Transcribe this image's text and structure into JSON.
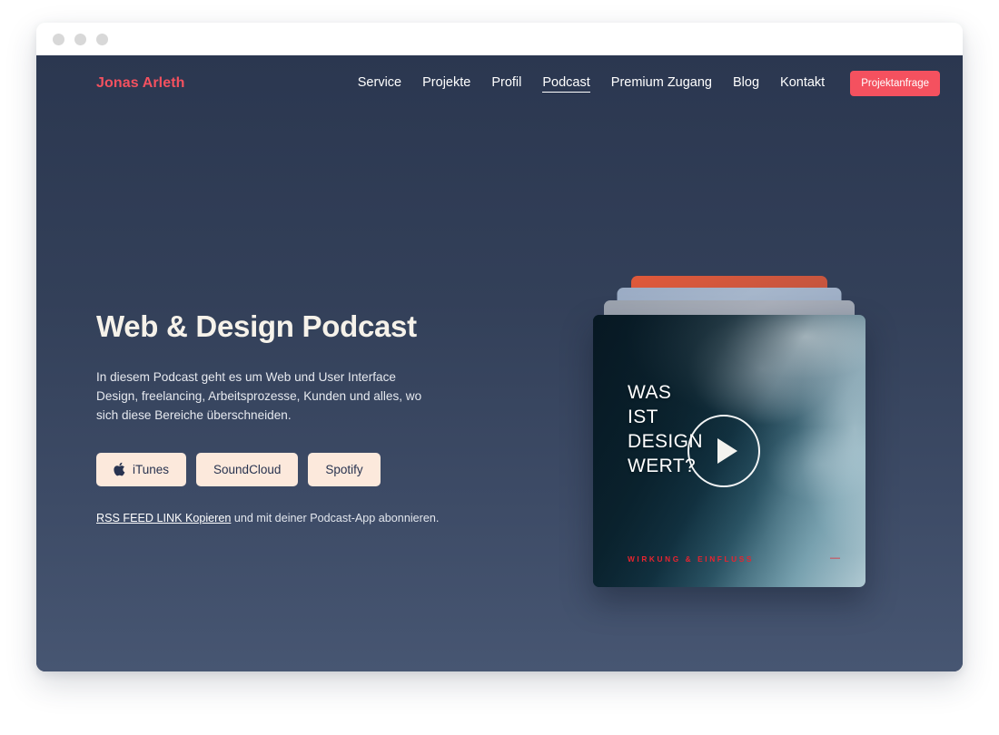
{
  "window": {
    "traffic_lights": [
      "close",
      "minimize",
      "zoom"
    ]
  },
  "nav": {
    "brand": "Jonas Arleth",
    "links": [
      {
        "label": "Service",
        "active": false
      },
      {
        "label": "Projekte",
        "active": false
      },
      {
        "label": "Profil",
        "active": false
      },
      {
        "label": "Podcast",
        "active": true
      },
      {
        "label": "Premium Zugang",
        "active": false
      },
      {
        "label": "Blog",
        "active": false
      },
      {
        "label": "Kontakt",
        "active": false
      }
    ],
    "cta_label": "Projektanfrage"
  },
  "hero": {
    "title": "Web & Design Podcast",
    "description": "In diesem Podcast geht es um Web und User Interface Design, freelancing, Arbeitsprozesse, Kunden und alles, wo sich diese Bereiche überschneiden.",
    "buttons": [
      {
        "label": "iTunes",
        "icon": "apple-icon"
      },
      {
        "label": "SoundCloud",
        "icon": ""
      },
      {
        "label": "Spotify",
        "icon": ""
      }
    ],
    "rss_link_label": "RSS FEED LINK Kopieren",
    "rss_suffix": " und mit deiner Podcast-App abonnieren."
  },
  "video_card": {
    "title_lines": [
      "WAS",
      "IST",
      "DESIGN",
      "WERT?"
    ],
    "tag": "WIRKUNG & EINFLUSS",
    "dash": "—",
    "play_label": "play-icon"
  },
  "colors": {
    "brand_red": "#f4515f",
    "tag_red": "#e8242f",
    "button_cream": "#fce9dc",
    "bg_navy_top": "#2b3750",
    "bg_navy_bottom": "#475672",
    "text_light": "#f6f2ea"
  }
}
